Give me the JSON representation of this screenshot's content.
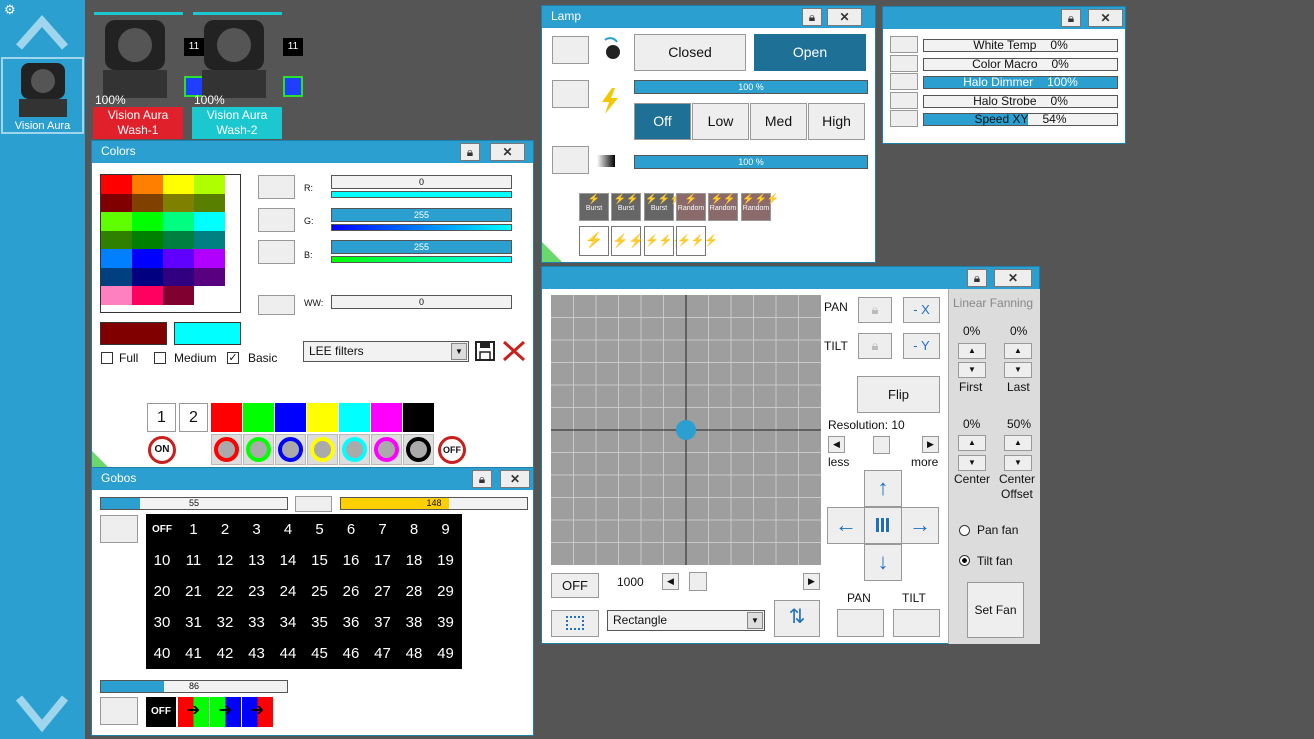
{
  "app": {
    "gear_icon": "gear-icon",
    "selected_fixture": "Vision Aura"
  },
  "fixtures": [
    {
      "name": "Vision Aura Wash-1",
      "line1": "Vision Aura",
      "line2": "Wash-1",
      "level": "100%",
      "channel": "11",
      "color": "#e0202a"
    },
    {
      "name": "Vision Aura Wash-2",
      "line1": "Vision Aura",
      "line2": "Wash-2",
      "level": "100%",
      "channel": "11",
      "color": "#1cc8d0"
    }
  ],
  "lamp": {
    "title": "Lamp",
    "closed": "Closed",
    "open": "Open",
    "intensity": "100 %",
    "dimmer": "100 %",
    "off": "Off",
    "low": "Low",
    "med": "Med",
    "high": "High",
    "fx": [
      "Burst",
      "Burst",
      "Burst",
      "Random",
      "Random",
      "Random"
    ]
  },
  "params": {
    "rows": [
      {
        "label": "White Temp",
        "value": "0%",
        "level": 0
      },
      {
        "label": "Color Macro",
        "value": "0%",
        "level": 0
      },
      {
        "label": "Halo Dimmer",
        "value": "100%",
        "level": 1
      },
      {
        "label": "Halo Strobe",
        "value": "0%",
        "level": 0
      },
      {
        "label": "Speed XY",
        "value": "54%",
        "level": 0.54
      }
    ]
  },
  "colors": {
    "title": "Colors",
    "r_label": "R:",
    "g_label": "G:",
    "b_label": "B:",
    "ww_label": "WW:",
    "r": "0",
    "g": "255",
    "b": "255",
    "ww": "0",
    "full": "Full",
    "medium": "Medium",
    "basic": "Basic",
    "filter": "LEE filters",
    "slot1": "1",
    "slot2": "2",
    "on": "ON",
    "off": "OFF",
    "palette": [
      "#ff0000",
      "#ff8000",
      "#ffff00",
      "#b0ff00",
      "#800000",
      "#804000",
      "#808000",
      "#587f00",
      "#60ff00",
      "#00ff00",
      "#00ff80",
      "#00ffff",
      "#308000",
      "#008000",
      "#008040",
      "#008080",
      "#0080ff",
      "#0000ff",
      "#6000ff",
      "#b000ff",
      "#004080",
      "#000080",
      "#300080",
      "#580080",
      "#ff80c0",
      "#ff0060",
      "#800030",
      "#ffffff"
    ],
    "current_a": "#800000",
    "current_b": "#00ffff",
    "strip": [
      "#ff0000",
      "#00ff00",
      "#0000ff",
      "#ffff00",
      "#00ffff",
      "#ff00ff",
      "#000000"
    ]
  },
  "gobos": {
    "title": "Gobos",
    "wheel1": "55",
    "wheel1_level": 0.21,
    "wheel2": "148",
    "wheel2_level": 0.58,
    "wheel3": "86",
    "wheel3_level": 0.34,
    "off": "OFF",
    "numbers": [
      "1",
      "2",
      "3",
      "4",
      "5",
      "6",
      "7",
      "8",
      "9",
      "10",
      "11",
      "12",
      "13",
      "14",
      "15",
      "16",
      "17",
      "18",
      "19",
      "20",
      "21",
      "22",
      "23",
      "24",
      "25",
      "26",
      "27",
      "28",
      "29",
      "30",
      "31",
      "32",
      "33",
      "34",
      "35",
      "36",
      "37",
      "38",
      "39",
      "40",
      "41",
      "42",
      "43",
      "44",
      "45",
      "46",
      "47",
      "48",
      "49"
    ]
  },
  "position": {
    "pan": "PAN",
    "tilt": "TILT",
    "minus_x": "- X",
    "minus_y": "- Y",
    "flip": "Flip",
    "resolution": "Resolution: 10",
    "less": "less",
    "more": "more",
    "off": "OFF",
    "speed": "1000",
    "shape": "Rectangle",
    "pan_bottom": "PAN",
    "tilt_bottom": "TILT",
    "fanning_title": "Linear Fanning",
    "first_val": "0%",
    "last_val": "0%",
    "first": "First",
    "last": "Last",
    "center_val": "0%",
    "offset_val": "50%",
    "center": "Center",
    "offset1": "Center",
    "offset2": "Offset",
    "pan_fan": "Pan fan",
    "tilt_fan": "Tilt fan",
    "set_fan": "Set Fan",
    "dot_x": 0.5,
    "dot_y": 0.5
  }
}
